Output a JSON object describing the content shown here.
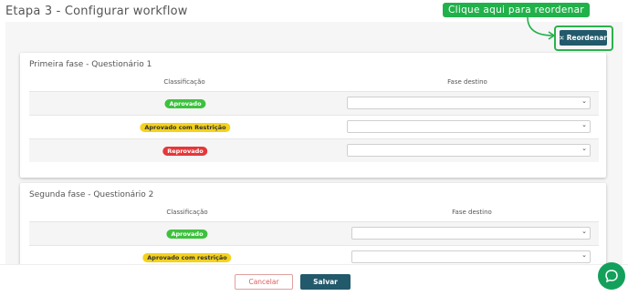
{
  "page": {
    "title": "Etapa 3 - Configurar workflow"
  },
  "hint": {
    "text": "Clique aqui para reordenar"
  },
  "reorder_button": {
    "label": "Reordenar",
    "icon": "shuffle-icon"
  },
  "phases": [
    {
      "title": "Primeira fase - Questionário 1",
      "col_classification": "Classificação",
      "col_destination": "Fase destino",
      "rows": [
        {
          "badge": "Aprovado",
          "color": "#3ec13e"
        },
        {
          "badge": "Aprovado com Restrição",
          "color": "#f4d21d"
        },
        {
          "badge": "Reprovado",
          "color": "#e5373a"
        }
      ]
    },
    {
      "title": "Segunda fase - Questionário 2",
      "col_classification": "Classificação",
      "col_destination": "Fase destino",
      "rows": [
        {
          "badge": "Aprovado",
          "color": "#3ec13e"
        },
        {
          "badge": "Aprovado com restrição",
          "color": "#f4d21d"
        }
      ]
    }
  ],
  "footer": {
    "cancel_label": "Cancelar",
    "save_label": "Salvar"
  },
  "chat": {
    "icon": "chat-bubble-icon"
  },
  "colors": {
    "primary": "#22596b",
    "hint_green": "#21b14a",
    "chat_green": "#13a05b"
  }
}
